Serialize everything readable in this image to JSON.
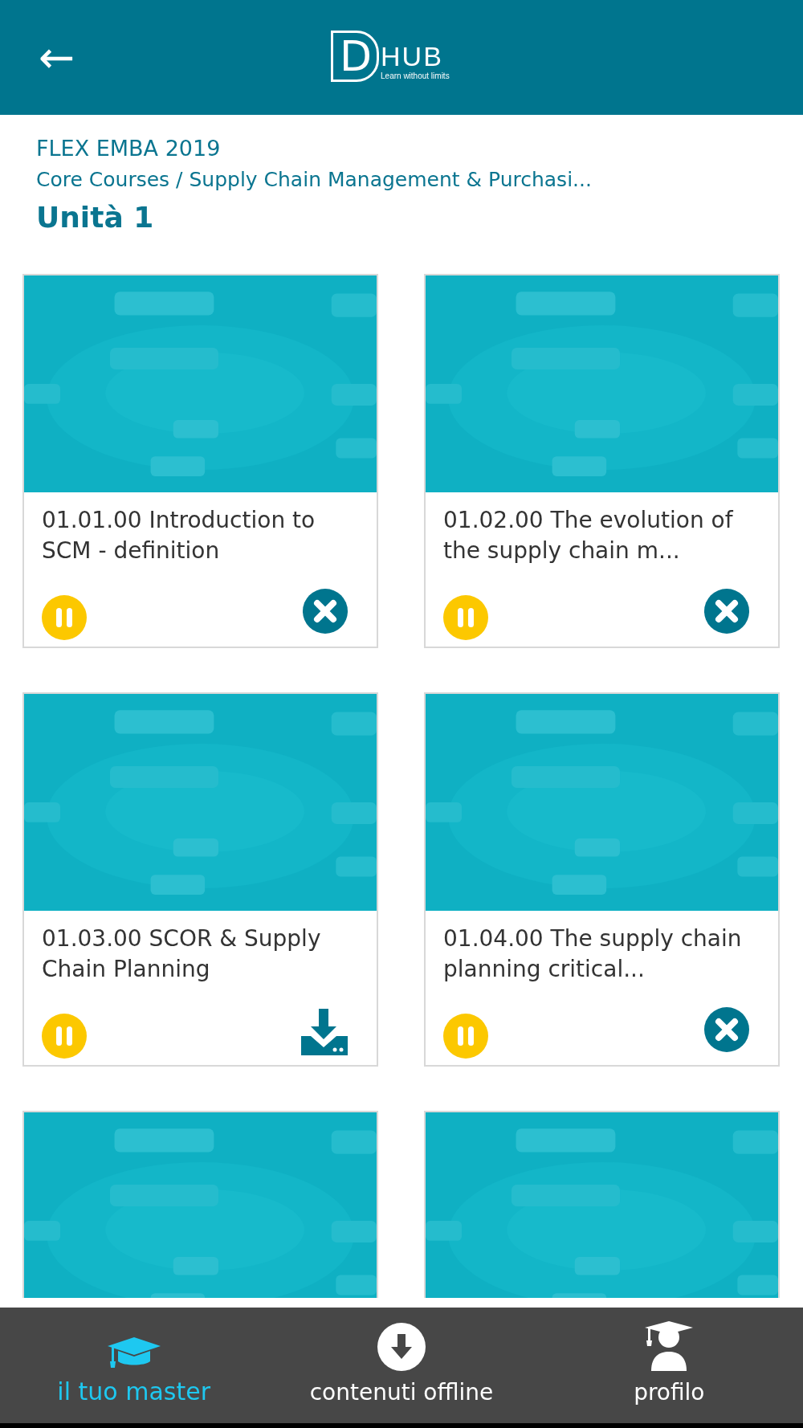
{
  "header": {
    "back": "←",
    "logo": {
      "mark": "D",
      "name": "HUB",
      "tagline": "Learn without limits"
    }
  },
  "breadcrumb": {
    "program": "FLEX EMBA 2019",
    "path": "Core Courses / Supply Chain Management & Purchasi...",
    "title": "Unità 1"
  },
  "cards": [
    {
      "thumbnail": {
        "kind": "picture"
      },
      "title": "01.01.00 Introduction to SCM - definition",
      "controls": [
        {
          "kind": "pause"
        },
        {
          "kind": "remove"
        }
      ]
    },
    {
      "thumbnail": {
        "kind": "picture"
      },
      "title": "01.02.00 The evolution of the supply chain m...",
      "controls": [
        {
          "kind": "pause"
        },
        {
          "kind": "remove"
        }
      ]
    },
    {
      "thumbnail": {
        "kind": "picture"
      },
      "title": "01.03.00 SCOR & Supply Chain Planning",
      "controls": [
        {
          "kind": "pause"
        },
        {
          "kind": "download"
        }
      ]
    },
    {
      "thumbnail": {
        "kind": "picture"
      },
      "title": "01.04.00 The supply chain planning critical...",
      "controls": [
        {
          "kind": "pause"
        },
        {
          "kind": "remove"
        }
      ]
    },
    {
      "thumbnail": {
        "kind": "picture"
      }
    },
    {
      "thumbnail": {
        "kind": "picture"
      }
    }
  ],
  "bottom_nav": [
    {
      "label": "il tuo master",
      "kind": "courses",
      "selected": true
    },
    {
      "label": "contenuti offline",
      "kind": "offline",
      "selected": false
    },
    {
      "label": "profilo",
      "kind": "profile",
      "selected": false
    }
  ]
}
